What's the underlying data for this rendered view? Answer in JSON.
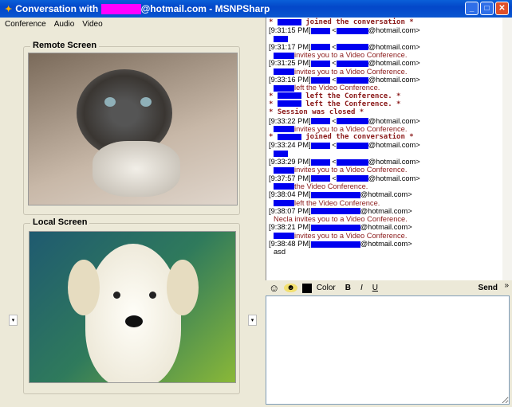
{
  "window": {
    "title_prefix": "Conversation with",
    "title_suffix": "@hotmail.com - MSNPSharp"
  },
  "menu": [
    "Conference",
    "Audio",
    "Video"
  ],
  "remote": {
    "label": "Remote Screen"
  },
  "local": {
    "label": "Local Screen"
  },
  "email_suffix": "@hotmail.com>",
  "chat": [
    {
      "kind": "status",
      "text": "joined the conversation"
    },
    {
      "kind": "header",
      "time": "[9:31:15 PM]"
    },
    {
      "kind": "msg",
      "text": ""
    },
    {
      "kind": "header",
      "time": "[9:31:17 PM]"
    },
    {
      "kind": "msg",
      "text": "invites you to a Video Conference."
    },
    {
      "kind": "header",
      "time": "[9:31:25 PM]"
    },
    {
      "kind": "msg",
      "text": "invites you to a Video Conference."
    },
    {
      "kind": "header",
      "time": "[9:33:16 PM]"
    },
    {
      "kind": "msg",
      "text": "left the Video Conference."
    },
    {
      "kind": "status",
      "text": "left the Conference."
    },
    {
      "kind": "status",
      "text": "left the Conference."
    },
    {
      "kind": "plainstatus",
      "text": "* Session was closed *"
    },
    {
      "kind": "header",
      "time": "[9:33:22 PM]"
    },
    {
      "kind": "msg",
      "text": "invites you to a Video Conference."
    },
    {
      "kind": "status",
      "text": "joined the conversation"
    },
    {
      "kind": "header",
      "time": "[9:33:24 PM]"
    },
    {
      "kind": "msg",
      "text": ""
    },
    {
      "kind": "header",
      "time": "[9:33:29 PM]"
    },
    {
      "kind": "msg",
      "text": "invites you to a Video Conference."
    },
    {
      "kind": "header",
      "time": "[9:37:57 PM]"
    },
    {
      "kind": "msg",
      "text": "the Video Conference."
    },
    {
      "kind": "header2",
      "time": "[9:38:04 PM]"
    },
    {
      "kind": "msg",
      "text": "left the Video Conference."
    },
    {
      "kind": "header2",
      "time": "[9:38:07 PM]"
    },
    {
      "kind": "plain",
      "text": "Necla invites you to a Video Conference."
    },
    {
      "kind": "header2",
      "time": "[9:38:21 PM]"
    },
    {
      "kind": "msg",
      "text": "invites you to a Video Conference."
    },
    {
      "kind": "header2",
      "time": "[9:38:48 PM]"
    },
    {
      "kind": "text",
      "text": "asd"
    }
  ],
  "toolbar": {
    "color": "Color",
    "bold": "B",
    "italic": "I",
    "underline": "U",
    "send": "Send",
    "more": "»"
  }
}
